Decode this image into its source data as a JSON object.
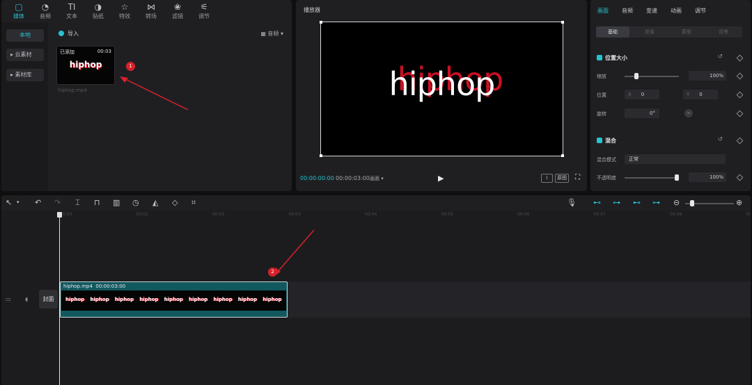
{
  "media_panel": {
    "tabs": [
      {
        "label": "媒体",
        "icon": "▢"
      },
      {
        "label": "音频",
        "icon": "◔"
      },
      {
        "label": "文本",
        "icon": "TI"
      },
      {
        "label": "贴纸",
        "icon": "◑"
      },
      {
        "label": "特效",
        "icon": "☆"
      },
      {
        "label": "转场",
        "icon": "⋈"
      },
      {
        "label": "滤镜",
        "icon": "❀"
      },
      {
        "label": "调节",
        "icon": "⚟"
      }
    ],
    "sidebar": [
      "本地",
      "▸ 云素材",
      "▸ 素材库"
    ],
    "import_label": "导入",
    "sort_label": "▦ 音频 ▾",
    "thumb": {
      "added": "已添加",
      "duration": "00:03",
      "text": "hiphop",
      "filename": "hiphop.mp4"
    },
    "step1": "1"
  },
  "player": {
    "title": "播放器",
    "screen_text": "hiphop",
    "current_time": "00:00:00:00",
    "total_time": "00:00:03:00",
    "mode": "画面 ▾",
    "play_icon": "▶",
    "original_label": "原图",
    "fullscreen_icon": "⛶",
    "wave_icon": "⌇"
  },
  "props": {
    "tabs": [
      "画面",
      "音频",
      "变速",
      "动画",
      "调节"
    ],
    "subtabs": [
      "基础",
      "抠像",
      "蒙版",
      "背景"
    ],
    "position_size": {
      "title": "位置大小",
      "scale_label": "缩放",
      "scale_value": "100%",
      "scale_fraction": 0.2,
      "position_label": "位置",
      "x_label": "X",
      "x_value": "0",
      "y_label": "Y",
      "y_value": "0",
      "rotate_label": "旋转",
      "rotate_value": "0°"
    },
    "blend": {
      "title": "混合",
      "mode_label": "混合模式",
      "mode_value": "正常",
      "opacity_label": "不透明度",
      "opacity_value": "100%",
      "opacity_fraction": 1.0
    }
  },
  "timeline": {
    "ruler": [
      "00:00",
      "00:01",
      "00:02",
      "00:03",
      "00:04",
      "00:05",
      "00:06",
      "00:07",
      "00:08",
      "00:09"
    ],
    "cover_label": "封面",
    "clip": {
      "name": "hiphop.mp4",
      "duration": "00:00:03:00",
      "frame_text": "hiphop",
      "frame_count": 9
    },
    "step2": "2"
  }
}
